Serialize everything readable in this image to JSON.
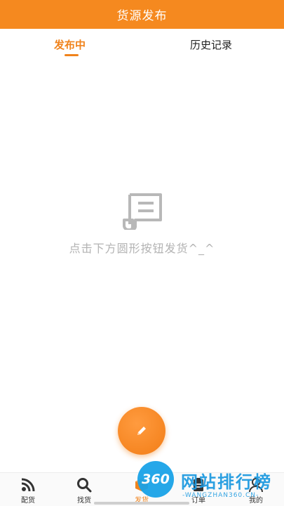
{
  "header": {
    "title": "货源发布"
  },
  "tabs": [
    {
      "label": "发布中",
      "active": true
    },
    {
      "label": "历史记录",
      "active": false
    }
  ],
  "empty_state": {
    "icon": "document-scroll-icon",
    "message": "点击下方圆形按钮发货^_^"
  },
  "fab": {
    "icon": "pencil-icon"
  },
  "tabbar": {
    "items": [
      {
        "label": "配货",
        "icon": "rss-icon",
        "active": false
      },
      {
        "label": "找货",
        "icon": "search-icon",
        "active": false
      },
      {
        "label": "发货",
        "icon": "box-icon",
        "active": true
      },
      {
        "label": "订单",
        "icon": "clipboard-icon",
        "active": false
      },
      {
        "label": "我的",
        "icon": "user-icon",
        "active": false
      }
    ]
  },
  "watermark": {
    "logo": "360",
    "title": "网站排行榜",
    "subtitle": "-WANGZHAN360.CN-"
  },
  "colors": {
    "accent": "#f5891f",
    "muted_text": "#b3b3b3"
  }
}
